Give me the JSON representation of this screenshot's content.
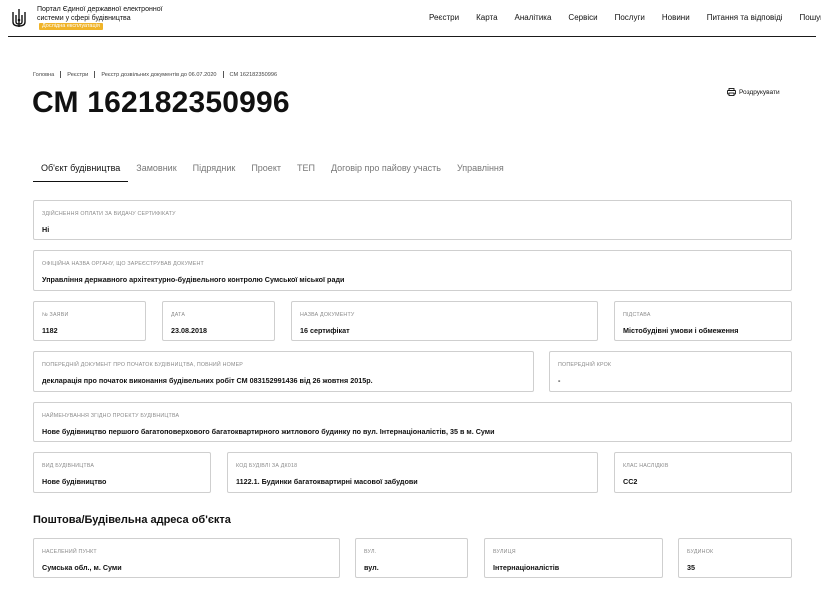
{
  "header": {
    "portal_name": "Портал Єдиної державної електронної системи у сфері будівництва",
    "beta_label": "Дослідна експлуатація",
    "nav": [
      "Реєстри",
      "Карта",
      "Аналітика",
      "Сервіси",
      "Послуги",
      "Новини",
      "Питання та відповіді",
      "Пошук"
    ]
  },
  "breadcrumb": [
    "Головна",
    "Реєстри",
    "Реєстр дозвільних документів до 06.07.2020",
    "СМ 162182350996"
  ],
  "page_title": "СМ 162182350996",
  "print_label": "Роздрукувати",
  "tabs": [
    "Об'єкт будівництва",
    "Замовник",
    "Підрядник",
    "Проект",
    "ТЕП",
    "Договір про пайову участь",
    "Управління"
  ],
  "fields": {
    "payment": {
      "label": "Здійснення оплати за видачу сертифікату",
      "value": "Ні"
    },
    "authority": {
      "label": "Офіційна назва органу, що зареєстрував документ",
      "value": "Управління державного архітектурно-будівельного контролю Сумської міської ради"
    },
    "application_no": {
      "label": "№ заяви",
      "value": "1182"
    },
    "date": {
      "label": "Дата",
      "value": "23.08.2018"
    },
    "doc_name": {
      "label": "Назва документу",
      "value": "16 сертифікат"
    },
    "basis": {
      "label": "Підстава",
      "value": "Містобудівні умови і обмеження"
    },
    "prev_doc": {
      "label": "Попередній документ про початок будівництва, повний номер",
      "value": "декларація про початок виконання будівельних робіт СМ 083152991436 від 26 жовтня 2015р."
    },
    "prev_step": {
      "label": "Попередній крок",
      "value": "-"
    },
    "project_name": {
      "label": "Найменування згідно проекту будівництва",
      "value": "Нове будівництво першого багатоповерхового багатоквартирного житлового будинку по вул. Інтернаціоналістів, 35 в м. Суми"
    },
    "construction_type": {
      "label": "Вид будівництва",
      "value": "Нове будівництво"
    },
    "building_code": {
      "label": "Код будівлі за ДК018",
      "value": "1122.1. Будинки багатоквартирні масової забудови"
    },
    "consequence_class": {
      "label": "Клас наслідків",
      "value": "СС2"
    }
  },
  "address_section": {
    "title": "Поштова/Будівельна адреса об'єкта",
    "settlement": {
      "label": "Населений пункт",
      "value": "Сумська обл., м. Суми"
    },
    "street_type": {
      "label": "Вул.",
      "value": "вул."
    },
    "street": {
      "label": "Вулиця",
      "value": "Інтернаціоналістів"
    },
    "building": {
      "label": "Будинок",
      "value": "35"
    }
  }
}
